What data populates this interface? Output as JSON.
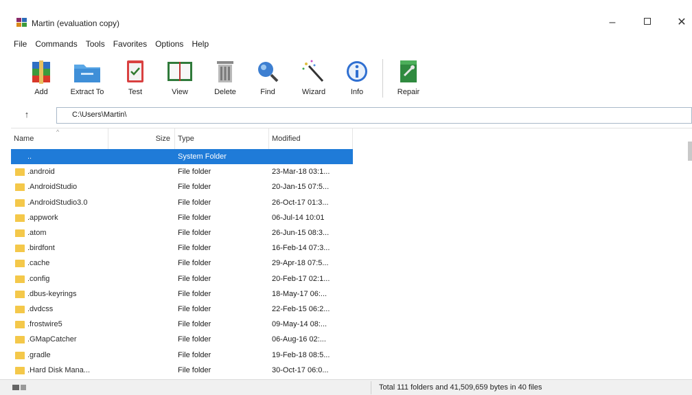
{
  "window": {
    "title": "Martin (evaluation copy)",
    "minimize_label": "–",
    "close_label": "✕"
  },
  "menu": [
    "File",
    "Commands",
    "Tools",
    "Favorites",
    "Options",
    "Help"
  ],
  "toolbar": [
    {
      "label": "Add",
      "icon": "add-archive-icon"
    },
    {
      "label": "Extract To",
      "icon": "extract-folder-icon"
    },
    {
      "label": "Test",
      "icon": "test-clipboard-icon"
    },
    {
      "label": "View",
      "icon": "view-book-icon"
    },
    {
      "label": "Delete",
      "icon": "trash-can-icon"
    },
    {
      "label": "Find",
      "icon": "magnifier-icon"
    },
    {
      "label": "Wizard",
      "icon": "magic-wand-icon"
    },
    {
      "label": "Info",
      "icon": "info-icon"
    },
    {
      "label": "Repair",
      "icon": "repair-kit-icon"
    }
  ],
  "address": {
    "up_label": "↑",
    "path": "C:\\Users\\Martin\\"
  },
  "columns": {
    "name": "Name",
    "size": "Size",
    "type": "Type",
    "modified": "Modified"
  },
  "files": [
    {
      "name": "..",
      "size": "",
      "type": "System Folder",
      "modified": "",
      "selected": true
    },
    {
      "name": ".android",
      "size": "",
      "type": "File folder",
      "modified": "23-Mar-18 03:1..."
    },
    {
      "name": ".AndroidStudio",
      "size": "",
      "type": "File folder",
      "modified": "20-Jan-15 07:5..."
    },
    {
      "name": ".AndroidStudio3.0",
      "size": "",
      "type": "File folder",
      "modified": "26-Oct-17 01:3..."
    },
    {
      "name": ".appwork",
      "size": "",
      "type": "File folder",
      "modified": "06-Jul-14 10:01"
    },
    {
      "name": ".atom",
      "size": "",
      "type": "File folder",
      "modified": "26-Jun-15 08:3..."
    },
    {
      "name": ".birdfont",
      "size": "",
      "type": "File folder",
      "modified": "16-Feb-14 07:3..."
    },
    {
      "name": ".cache",
      "size": "",
      "type": "File folder",
      "modified": "29-Apr-18 07:5..."
    },
    {
      "name": ".config",
      "size": "",
      "type": "File folder",
      "modified": "20-Feb-17 02:1..."
    },
    {
      "name": ".dbus-keyrings",
      "size": "",
      "type": "File folder",
      "modified": "18-May-17 06:..."
    },
    {
      "name": ".dvdcss",
      "size": "",
      "type": "File folder",
      "modified": "22-Feb-15 06:2..."
    },
    {
      "name": ".frostwire5",
      "size": "",
      "type": "File folder",
      "modified": "09-May-14 08:..."
    },
    {
      "name": ".GMapCatcher",
      "size": "",
      "type": "File folder",
      "modified": "06-Aug-16 02:..."
    },
    {
      "name": ".gradle",
      "size": "",
      "type": "File folder",
      "modified": "19-Feb-18 08:5..."
    },
    {
      "name": ".Hard Disk Mana...",
      "size": "",
      "type": "File folder",
      "modified": "30-Oct-17 06:0..."
    }
  ],
  "status": {
    "summary": "Total 111 folders and 41,509,659 bytes in 40 files"
  },
  "colors": {
    "selection": "#1f7bd8",
    "folder": "#f4c84a"
  }
}
